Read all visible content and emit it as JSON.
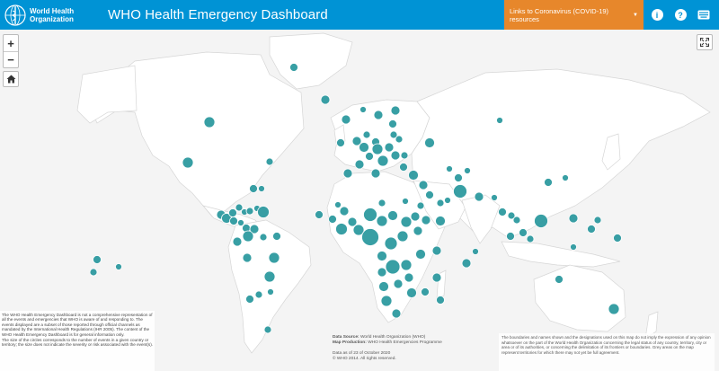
{
  "header": {
    "org_name_line1": "World Health",
    "org_name_line2": "Organization",
    "app_title": "WHO Health Emergency Dashboard",
    "links_dropdown_label": "Links to Coronavirus (COVID-19) resources",
    "info_icon": "info-icon",
    "help_icon": "help-icon",
    "keyboard_icon": "keyboard-icon",
    "bar_color": "#0093d5",
    "dropdown_color": "#e7872b"
  },
  "map_controls": {
    "zoom_in": "+",
    "zoom_out": "−",
    "home_icon": "home-icon",
    "fullscreen_icon": "fullscreen-icon"
  },
  "map": {
    "bubble_color": "#2e9aa0",
    "land_color": "#ffffff",
    "border_color": "#d6d6d6"
  },
  "disclaimer_left": {
    "p1": "The WHO Health Emergency Dashboard is not a comprehensive representation of all the events and emergencies that WHO is aware of and responding to. The events displayed are a subset of those reported through official channels as mandated by the International Health Regulations (IHR 2005). The content of the WHO Health Emergency Dashboard is for general information only.",
    "p2": "The size of the circles corresponds to the number of events in a given country or territory; the size does not indicate the severity or risk associated with the event(s)."
  },
  "footer_mid": {
    "source_label": "Data Source:",
    "source_value": "World Health Organization (WHO)",
    "production_label": "Map Production:",
    "production_value": "WHO Health Emergencies Programme",
    "date": "Data as of 23 of October 2020",
    "copyright": "© WHO 2014. All rights reserved."
  },
  "footer_right": {
    "text": "The boundaries and names shown and the designations used on this map do not imply the expression of any opinion whatsoever on the part of the World Health Organization concerning the legal status of any country, territory, city or area or of its authorities, or concerning the delimitation of its frontiers or boundaries. Grey areas on the map represent territories for which there may not yet be full agreement."
  }
}
